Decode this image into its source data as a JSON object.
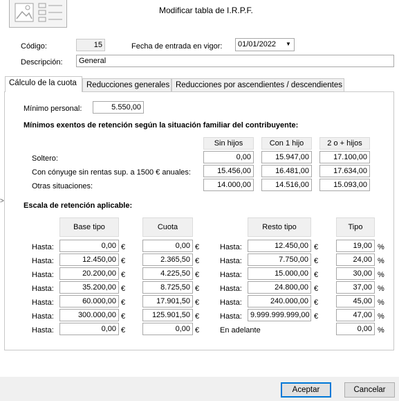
{
  "window": {
    "title": "Modificar tabla de I.R.P.F."
  },
  "header": {
    "codigo_label": "Código:",
    "codigo_value": "15",
    "fecha_label": "Fecha de entrada en vigor:",
    "fecha_value": "01/01/2022",
    "descripcion_label": "Descripción:",
    "descripcion_value": "General"
  },
  "tabs": [
    {
      "label": "Cálculo de la cuota",
      "active": true
    },
    {
      "label": "Reducciones generales",
      "active": false
    },
    {
      "label": "Reducciones por ascendientes / descendientes",
      "active": false
    }
  ],
  "minimo": {
    "label": "Mínimo personal:",
    "value": "5.550,00"
  },
  "exentos": {
    "title": "Mínimos exentos de retención según la situación familiar del contribuyente:",
    "columns": [
      "Sin hijos",
      "Con 1 hijo",
      "2 o + hijos"
    ],
    "rows": [
      {
        "label": "Soltero:",
        "values": [
          "0,00",
          "15.947,00",
          "17.100,00"
        ]
      },
      {
        "label": "Con cónyuge sin rentas sup. a 1500 € anuales:",
        "values": [
          "15.456,00",
          "16.481,00",
          "17.634,00"
        ]
      },
      {
        "label": "Otras situaciones:",
        "values": [
          "14.000,00",
          "14.516,00",
          "15.093,00"
        ]
      }
    ]
  },
  "escala": {
    "title": "Escala de retención aplicable:",
    "columns": [
      "Base tipo",
      "Cuota",
      "Resto tipo",
      "Tipo"
    ],
    "row_label": "Hasta:",
    "en_adelante": "En adelante",
    "euro": "€",
    "percent": "%",
    "rows": [
      {
        "base": "0,00",
        "cuota": "0,00",
        "resto": "12.450,00",
        "tipo": "19,00"
      },
      {
        "base": "12.450,00",
        "cuota": "2.365,50",
        "resto": "7.750,00",
        "tipo": "24,00"
      },
      {
        "base": "20.200,00",
        "cuota": "4.225,50",
        "resto": "15.000,00",
        "tipo": "30,00"
      },
      {
        "base": "35.200,00",
        "cuota": "8.725,50",
        "resto": "24.800,00",
        "tipo": "37,00"
      },
      {
        "base": "60.000,00",
        "cuota": "17.901,50",
        "resto": "240.000,00",
        "tipo": "45,00"
      },
      {
        "base": "300.000,00",
        "cuota": "125.901,50",
        "resto": "9.999.999.999,00",
        "tipo": "47,00"
      },
      {
        "base": "0,00",
        "cuota": "0,00",
        "resto": "",
        "tipo": "0,00"
      }
    ]
  },
  "buttons": {
    "accept": "Aceptar",
    "cancel": "Cancelar"
  },
  "icons": {
    "top_left": "form-image-icon",
    "left_edge": "chevron-right-icon",
    "dropdown": "chevron-down-icon"
  }
}
